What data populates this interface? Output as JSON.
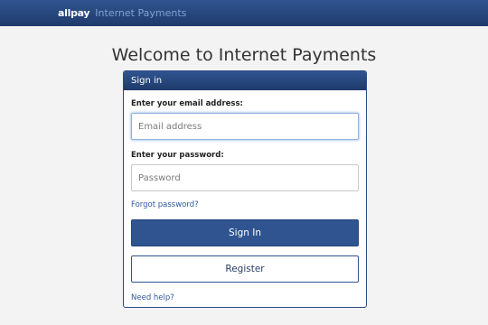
{
  "header": {
    "brand": "allpay",
    "app_name": "Internet Payments"
  },
  "main": {
    "title": "Welcome to Internet Payments"
  },
  "signin_panel": {
    "title": "Sign in",
    "email_label": "Enter your email address:",
    "email_placeholder": "Email address",
    "email_value": "",
    "password_label": "Enter your password:",
    "password_placeholder": "Password",
    "password_value": "",
    "forgot_link": "Forgot password?",
    "signin_button": "Sign In",
    "register_button": "Register",
    "help_link": "Need help?"
  },
  "colors": {
    "brand_blue": "#2f5490",
    "header_dark": "#1f3a6b",
    "link": "#2f5aa3",
    "background": "#f3f3f4"
  }
}
